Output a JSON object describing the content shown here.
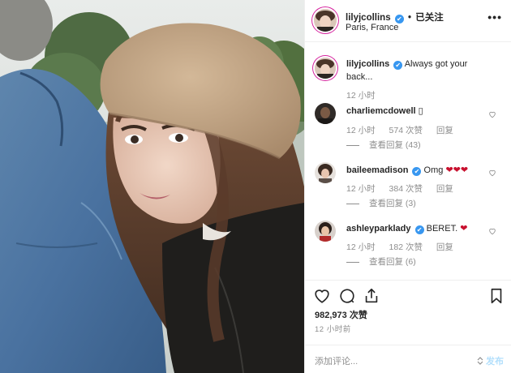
{
  "header": {
    "username": "lilyjcollins",
    "verified_mark": "✔",
    "separator": "•",
    "follow_status": "已关注",
    "location": "Paris, France",
    "more_icon": "more-dots-icon"
  },
  "caption": {
    "username": "lilyjcollins",
    "text": "Always got your back...",
    "time": "12 小时"
  },
  "comments": [
    {
      "username": "charliemcdowell",
      "text": "▯",
      "time": "12 小时",
      "likes": "574 次赞",
      "reply": "回复",
      "view_replies": "查看回复 (43)"
    },
    {
      "username": "baileemadison",
      "text": "Omg ",
      "text_hearts": "❤❤❤",
      "time": "12 小时",
      "likes": "384 次赞",
      "reply": "回复",
      "view_replies": "查看回复 (3)"
    },
    {
      "username": "ashleyparklady",
      "text": "BERET. ",
      "text_hearts": "❤",
      "time": "12 小时",
      "likes": "182 次赞",
      "reply": "回复",
      "view_replies": "查看回复 (6)"
    }
  ],
  "actions": {
    "like_icon": "heart-icon",
    "comment_icon": "comment-icon",
    "share_icon": "share-icon",
    "save_icon": "bookmark-icon",
    "likes_count": "982,973 次赞",
    "timestamp": "12 小时前"
  },
  "add_comment": {
    "placeholder": "添加评论...",
    "post_label": "发布"
  },
  "colors": {
    "accent_blue": "#3897f0",
    "heart_red": "#c8102e",
    "muted_text": "#8e8e8e",
    "post_disabled": "#b2dffc"
  }
}
